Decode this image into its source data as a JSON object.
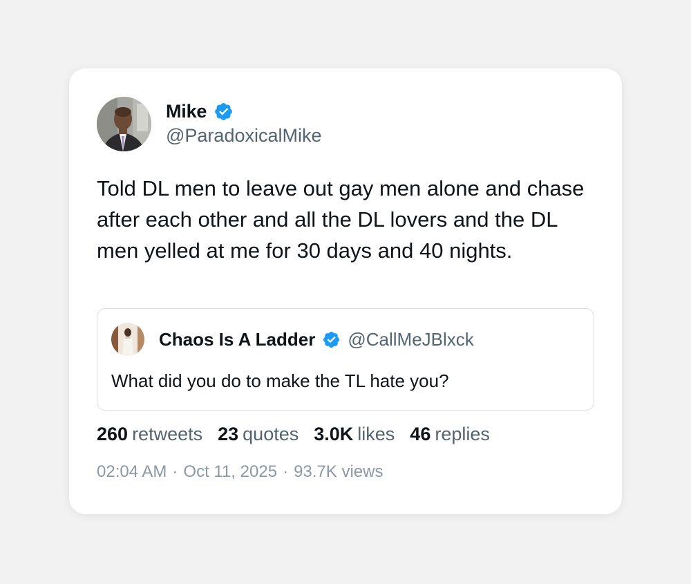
{
  "colors": {
    "background": "#f2f2f2",
    "card": "#ffffff",
    "verified": "#1d9bf0",
    "text_primary": "#0f1419",
    "text_secondary": "#536471",
    "meta_text": "#8b98a5"
  },
  "author": {
    "name": "Mike",
    "handle": "@ParadoxicalMike",
    "verified_icon": "verified-badge-icon"
  },
  "tweet": {
    "text": "Told DL men to leave out gay men alone and chase after each other and all the DL lovers and the DL men yelled at me for 30 days and 40 nights."
  },
  "quote": {
    "name": "Chaos Is A Ladder",
    "handle": "@CallMeJBlxck",
    "text": "What did you do to make the TL hate you?"
  },
  "stats": {
    "retweets_count": "260",
    "retweets_label": "retweets",
    "quotes_count": "23",
    "quotes_label": "quotes",
    "likes_count": "3.0K",
    "likes_label": "likes",
    "replies_count": "46",
    "replies_label": "replies"
  },
  "meta": {
    "time": "02:04 AM",
    "separator": "·",
    "date": "Oct 11, 2025",
    "views": "93.7K views"
  }
}
